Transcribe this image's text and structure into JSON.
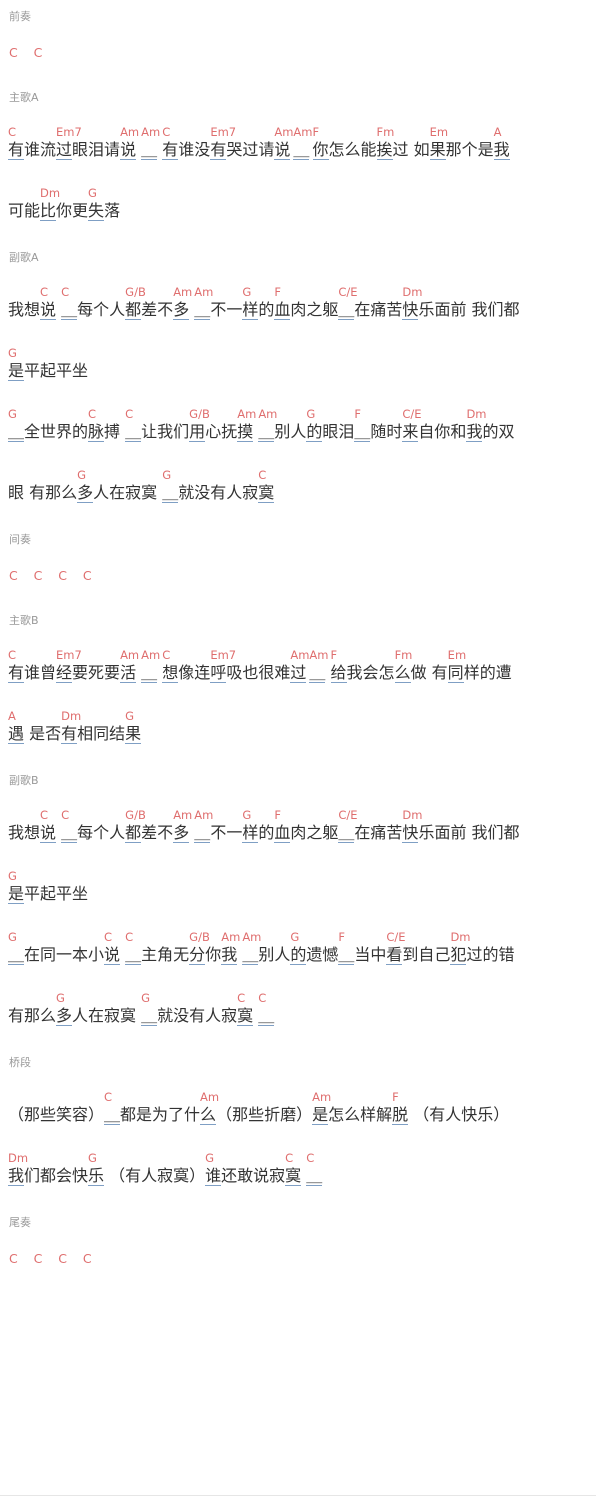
{
  "document": {
    "type": "chord-chart",
    "language": "zh-CN",
    "colors": {
      "chord": "#df6e6e",
      "lyric": "#333333",
      "section_label": "#999999",
      "underline": "#7f9fc4",
      "background": "#ffffff"
    }
  },
  "sections": [
    {
      "label": "前奏",
      "kind": "instrumental",
      "chord_only_lines": [
        "C    C"
      ],
      "lines": []
    },
    {
      "label": "主歌A",
      "kind": "verse",
      "chord_only_lines": [],
      "lines": [
        {
          "segments": [
            {
              "chord": "C",
              "lyric": "有谁流"
            },
            {
              "chord": "Em7",
              "lyric": "过眼泪请"
            },
            {
              "chord": "Am",
              "lyric": "说 "
            },
            {
              "chord": "Am",
              "lyric": "＿ "
            },
            {
              "chord": "C",
              "lyric": "有谁没"
            },
            {
              "chord": "Em7",
              "lyric": "有哭过请"
            },
            {
              "chord": "Am",
              "lyric": "说"
            },
            {
              "chord": "Am",
              "lyric": "＿"
            },
            {
              "chord": "F",
              "lyric": "你怎么能"
            },
            {
              "chord": "Fm",
              "lyric": "挨过 如"
            },
            {
              "chord": "Em",
              "lyric": "果那个是"
            },
            {
              "chord": "A",
              "lyric": "我"
            }
          ]
        },
        {
          "segments": [
            {
              "chord": "",
              "lyric": "可能"
            },
            {
              "chord": "Dm",
              "lyric": "比你更"
            },
            {
              "chord": "G",
              "lyric": "失落"
            }
          ]
        }
      ]
    },
    {
      "label": "副歌A",
      "kind": "chorus",
      "chord_only_lines": [],
      "lines": [
        {
          "segments": [
            {
              "chord": "",
              "lyric": "我想"
            },
            {
              "chord": "C",
              "lyric": "说 "
            },
            {
              "chord": "C",
              "lyric": "＿每个人"
            },
            {
              "chord": "G/B",
              "lyric": "都差不"
            },
            {
              "chord": "Am",
              "lyric": "多 "
            },
            {
              "chord": "Am",
              "lyric": "＿不一"
            },
            {
              "chord": "G",
              "lyric": "样的"
            },
            {
              "chord": "F",
              "lyric": "血肉之躯"
            },
            {
              "chord": "C/E",
              "lyric": "＿在痛苦"
            },
            {
              "chord": "Dm",
              "lyric": "快乐面前 我们都"
            }
          ]
        },
        {
          "segments": [
            {
              "chord": "G",
              "lyric": "是平起平坐"
            }
          ]
        },
        {
          "segments": [
            {
              "chord": "G",
              "lyric": "＿全世界的"
            },
            {
              "chord": "C",
              "lyric": "脉搏 "
            },
            {
              "chord": "C",
              "lyric": "＿让我们"
            },
            {
              "chord": "G/B",
              "lyric": "用心抚"
            },
            {
              "chord": "Am",
              "lyric": "摸 "
            },
            {
              "chord": "Am",
              "lyric": "＿别人"
            },
            {
              "chord": "G",
              "lyric": "的眼泪"
            },
            {
              "chord": "F",
              "lyric": "＿随时"
            },
            {
              "chord": "C/E",
              "lyric": "来自你和"
            },
            {
              "chord": "Dm",
              "lyric": "我的双"
            }
          ]
        },
        {
          "segments": [
            {
              "chord": "",
              "lyric": "眼 有那么"
            },
            {
              "chord": "G",
              "lyric": "多人在寂寞 "
            },
            {
              "chord": "G",
              "lyric": "＿就没有人寂"
            },
            {
              "chord": "C",
              "lyric": "寞"
            }
          ]
        }
      ]
    },
    {
      "label": "间奏",
      "kind": "instrumental",
      "chord_only_lines": [
        "C    C    C    C"
      ],
      "lines": []
    },
    {
      "label": "主歌B",
      "kind": "verse",
      "chord_only_lines": [],
      "lines": [
        {
          "segments": [
            {
              "chord": "C",
              "lyric": "有谁曾"
            },
            {
              "chord": "Em7",
              "lyric": "经要死要"
            },
            {
              "chord": "Am",
              "lyric": "活 "
            },
            {
              "chord": "Am",
              "lyric": "＿ "
            },
            {
              "chord": "C",
              "lyric": "想像连"
            },
            {
              "chord": "Em7",
              "lyric": "呼吸也很难"
            },
            {
              "chord": "Am",
              "lyric": "过"
            },
            {
              "chord": "Am",
              "lyric": "＿ "
            },
            {
              "chord": "F",
              "lyric": "给我会怎"
            },
            {
              "chord": "Fm",
              "lyric": "么做 有"
            },
            {
              "chord": "Em",
              "lyric": "同样的遭"
            }
          ]
        },
        {
          "segments": [
            {
              "chord": "A",
              "lyric": "遇 是否"
            },
            {
              "chord": "Dm",
              "lyric": "有相同结"
            },
            {
              "chord": "G",
              "lyric": "果"
            }
          ]
        }
      ]
    },
    {
      "label": "副歌B",
      "kind": "chorus",
      "chord_only_lines": [],
      "lines": [
        {
          "segments": [
            {
              "chord": "",
              "lyric": "我想"
            },
            {
              "chord": "C",
              "lyric": "说 "
            },
            {
              "chord": "C",
              "lyric": "＿每个人"
            },
            {
              "chord": "G/B",
              "lyric": "都差不"
            },
            {
              "chord": "Am",
              "lyric": "多 "
            },
            {
              "chord": "Am",
              "lyric": "＿不一"
            },
            {
              "chord": "G",
              "lyric": "样的"
            },
            {
              "chord": "F",
              "lyric": "血肉之躯"
            },
            {
              "chord": "C/E",
              "lyric": "＿在痛苦"
            },
            {
              "chord": "Dm",
              "lyric": "快乐面前 我们都"
            }
          ]
        },
        {
          "segments": [
            {
              "chord": "G",
              "lyric": "是平起平坐"
            }
          ]
        },
        {
          "segments": [
            {
              "chord": "G",
              "lyric": "＿在同一本小"
            },
            {
              "chord": "C",
              "lyric": "说 "
            },
            {
              "chord": "C",
              "lyric": "＿主角无"
            },
            {
              "chord": "G/B",
              "lyric": "分你"
            },
            {
              "chord": "Am",
              "lyric": "我 "
            },
            {
              "chord": "Am",
              "lyric": "＿别人"
            },
            {
              "chord": "G",
              "lyric": "的遗憾"
            },
            {
              "chord": "F",
              "lyric": "＿当中"
            },
            {
              "chord": "C/E",
              "lyric": "看到自己"
            },
            {
              "chord": "Dm",
              "lyric": "犯过的错"
            }
          ]
        },
        {
          "segments": [
            {
              "chord": "",
              "lyric": "有那么"
            },
            {
              "chord": "G",
              "lyric": "多人在寂寞 "
            },
            {
              "chord": "G",
              "lyric": "＿就没有人寂"
            },
            {
              "chord": "C",
              "lyric": "寞 "
            },
            {
              "chord": "C",
              "lyric": "＿"
            }
          ]
        }
      ]
    },
    {
      "label": "桥段",
      "kind": "bridge",
      "chord_only_lines": [],
      "lines": [
        {
          "segments": [
            {
              "chord": "",
              "lyric": "（那些笑容）"
            },
            {
              "chord": "C",
              "lyric": "＿都是为了什"
            },
            {
              "chord": "Am",
              "lyric": "么（那些折磨）"
            },
            {
              "chord": "Am",
              "lyric": "是怎么样解"
            },
            {
              "chord": "F",
              "lyric": "脱 （有人快乐）"
            }
          ]
        },
        {
          "segments": [
            {
              "chord": "Dm",
              "lyric": "我们都会快"
            },
            {
              "chord": "G",
              "lyric": "乐 （有人寂寞）"
            },
            {
              "chord": "G",
              "lyric": "谁还敢说寂"
            },
            {
              "chord": "C",
              "lyric": "寞 "
            },
            {
              "chord": "C",
              "lyric": "＿"
            }
          ]
        }
      ]
    },
    {
      "label": "尾奏",
      "kind": "instrumental",
      "chord_only_lines": [
        "C    C    C    C"
      ],
      "lines": []
    }
  ]
}
